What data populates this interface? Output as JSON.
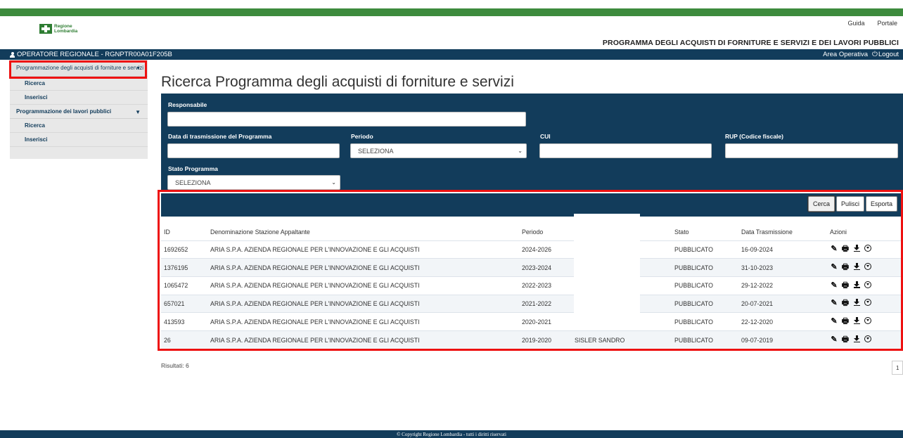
{
  "header": {
    "logo_line1": "Regione",
    "logo_line2": "Lombardia",
    "links": [
      "Guida",
      "Portale"
    ],
    "program_title": "PROGRAMMA DEGLI ACQUISTI DI FORNITURE E SERVIZI E DEI LAVORI PUBBLICI"
  },
  "userbar": {
    "user": "OPERATORE REGIONALE - RGNPTR00A01F205B",
    "area": "Area Operativa",
    "logout": "Logout"
  },
  "sidebar": {
    "section1": "Programmazione degli acquisti di forniture e servizi",
    "section1_items": [
      "Ricerca",
      "Inserisci"
    ],
    "section2": "Programmazione dei lavori pubblici",
    "section2_items": [
      "Ricerca",
      "Inserisci"
    ]
  },
  "main": {
    "title": "Ricerca Programma degli acquisti di forniture e servizi"
  },
  "filters": {
    "responsabile_label": "Responsabile",
    "data_label": "Data di trasmissione del Programma",
    "periodo_label": "Periodo",
    "periodo_value": "SELEZIONA",
    "cui_label": "CUI",
    "rup_label": "RUP (Codice fiscale)",
    "stato_label": "Stato Programma",
    "stato_value": "SELEZIONA"
  },
  "buttons": {
    "cerca": "Cerca",
    "pulisci": "Pulisci",
    "esporta": "Esporta"
  },
  "table": {
    "columns": [
      "ID",
      "Denominazione Stazione Appaltante",
      "Periodo",
      "",
      "Stato",
      "Data Trasmissione",
      "Azioni"
    ],
    "rows": [
      {
        "id": "1692652",
        "den": "ARIA S.P.A. AZIENDA REGIONALE PER L'INNOVAZIONE E GLI ACQUISTI",
        "periodo": "2024-2026",
        "resp": "",
        "stato": "PUBBLICATO",
        "data": "16-09-2024"
      },
      {
        "id": "1376195",
        "den": "ARIA S.P.A. AZIENDA REGIONALE PER L'INNOVAZIONE E GLI ACQUISTI",
        "periodo": "2023-2024",
        "resp": "",
        "stato": "PUBBLICATO",
        "data": "31-10-2023"
      },
      {
        "id": "1065472",
        "den": "ARIA S.P.A. AZIENDA REGIONALE PER L'INNOVAZIONE E GLI ACQUISTI",
        "periodo": "2022-2023",
        "resp": "",
        "stato": "PUBBLICATO",
        "data": "29-12-2022"
      },
      {
        "id": "657021",
        "den": "ARIA S.P.A. AZIENDA REGIONALE PER L'INNOVAZIONE E GLI ACQUISTI",
        "periodo": "2021-2022",
        "resp": "",
        "stato": "PUBBLICATO",
        "data": "20-07-2021"
      },
      {
        "id": "413593",
        "den": "ARIA S.P.A. AZIENDA REGIONALE PER L'INNOVAZIONE E GLI ACQUISTI",
        "periodo": "2020-2021",
        "resp": "",
        "stato": "PUBBLICATO",
        "data": "22-12-2020"
      },
      {
        "id": "26",
        "den": "ARIA S.P.A. AZIENDA REGIONALE PER L'INNOVAZIONE E GLI ACQUISTI",
        "periodo": "2019-2020",
        "resp": "SISLER SANDRO",
        "stato": "PUBBLICATO",
        "data": "09-07-2019"
      }
    ],
    "action_icons": [
      "edit-icon",
      "print-icon",
      "download-icon",
      "circle-download-icon"
    ]
  },
  "results": {
    "count_text": "Risultati: 6",
    "page": "1"
  },
  "footer": {
    "copyright": "© Copyright Regione Lombardia - tutti i diritti riservati"
  },
  "colors": {
    "navy": "#123c5b",
    "green": "#3d8b3d",
    "highlight_red": "#ee1111"
  }
}
